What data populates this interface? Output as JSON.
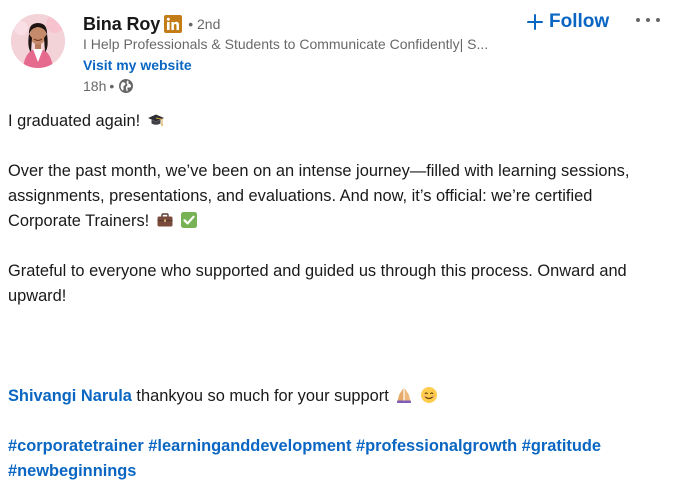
{
  "author": {
    "name": "Bina Roy",
    "badge_icon": "linkedin-in-icon",
    "degree": "• 2nd",
    "headline": "I Help Professionals & Students to Communicate Confidently| S...",
    "website_label": "Visit my website",
    "time": "18h",
    "meta_dot": "•",
    "visibility_icon": "globe-icon"
  },
  "actions": {
    "follow_label": "Follow",
    "follow_icon": "plus-icon",
    "more_icon": "more-horizontal-icon"
  },
  "post": {
    "line1": "I graduated again!",
    "line1_emoji": "graduation-cap-emoji",
    "para2": "Over the past month, we’ve been on an intense journey—filled with learning sessions, assignments, presentations, and evaluations. And now, it’s official: we’re certified Corporate Trainers!",
    "para2_emojis": [
      "briefcase-emoji",
      "check-mark-emoji"
    ],
    "para3": "Grateful to everyone who supported and guided us through this process. Onward and upward!",
    "mention": "Shivangi Narula",
    "mention_text": " thankyou so much for your support",
    "mention_emojis": [
      "folded-hands-emoji",
      "smiling-face-emoji"
    ],
    "hashtags": [
      "#corporatetrainer",
      "#learninganddevelopment",
      "#professionalgrowth",
      "#gratitude",
      "#newbeginnings"
    ]
  },
  "colors": {
    "link_blue": "#0a66c2",
    "text_primary": "rgba(0,0,0,0.9)",
    "text_secondary": "rgba(0,0,0,0.6)",
    "linkedin_brand": "#0a66c2",
    "check_green": "#77b255"
  }
}
